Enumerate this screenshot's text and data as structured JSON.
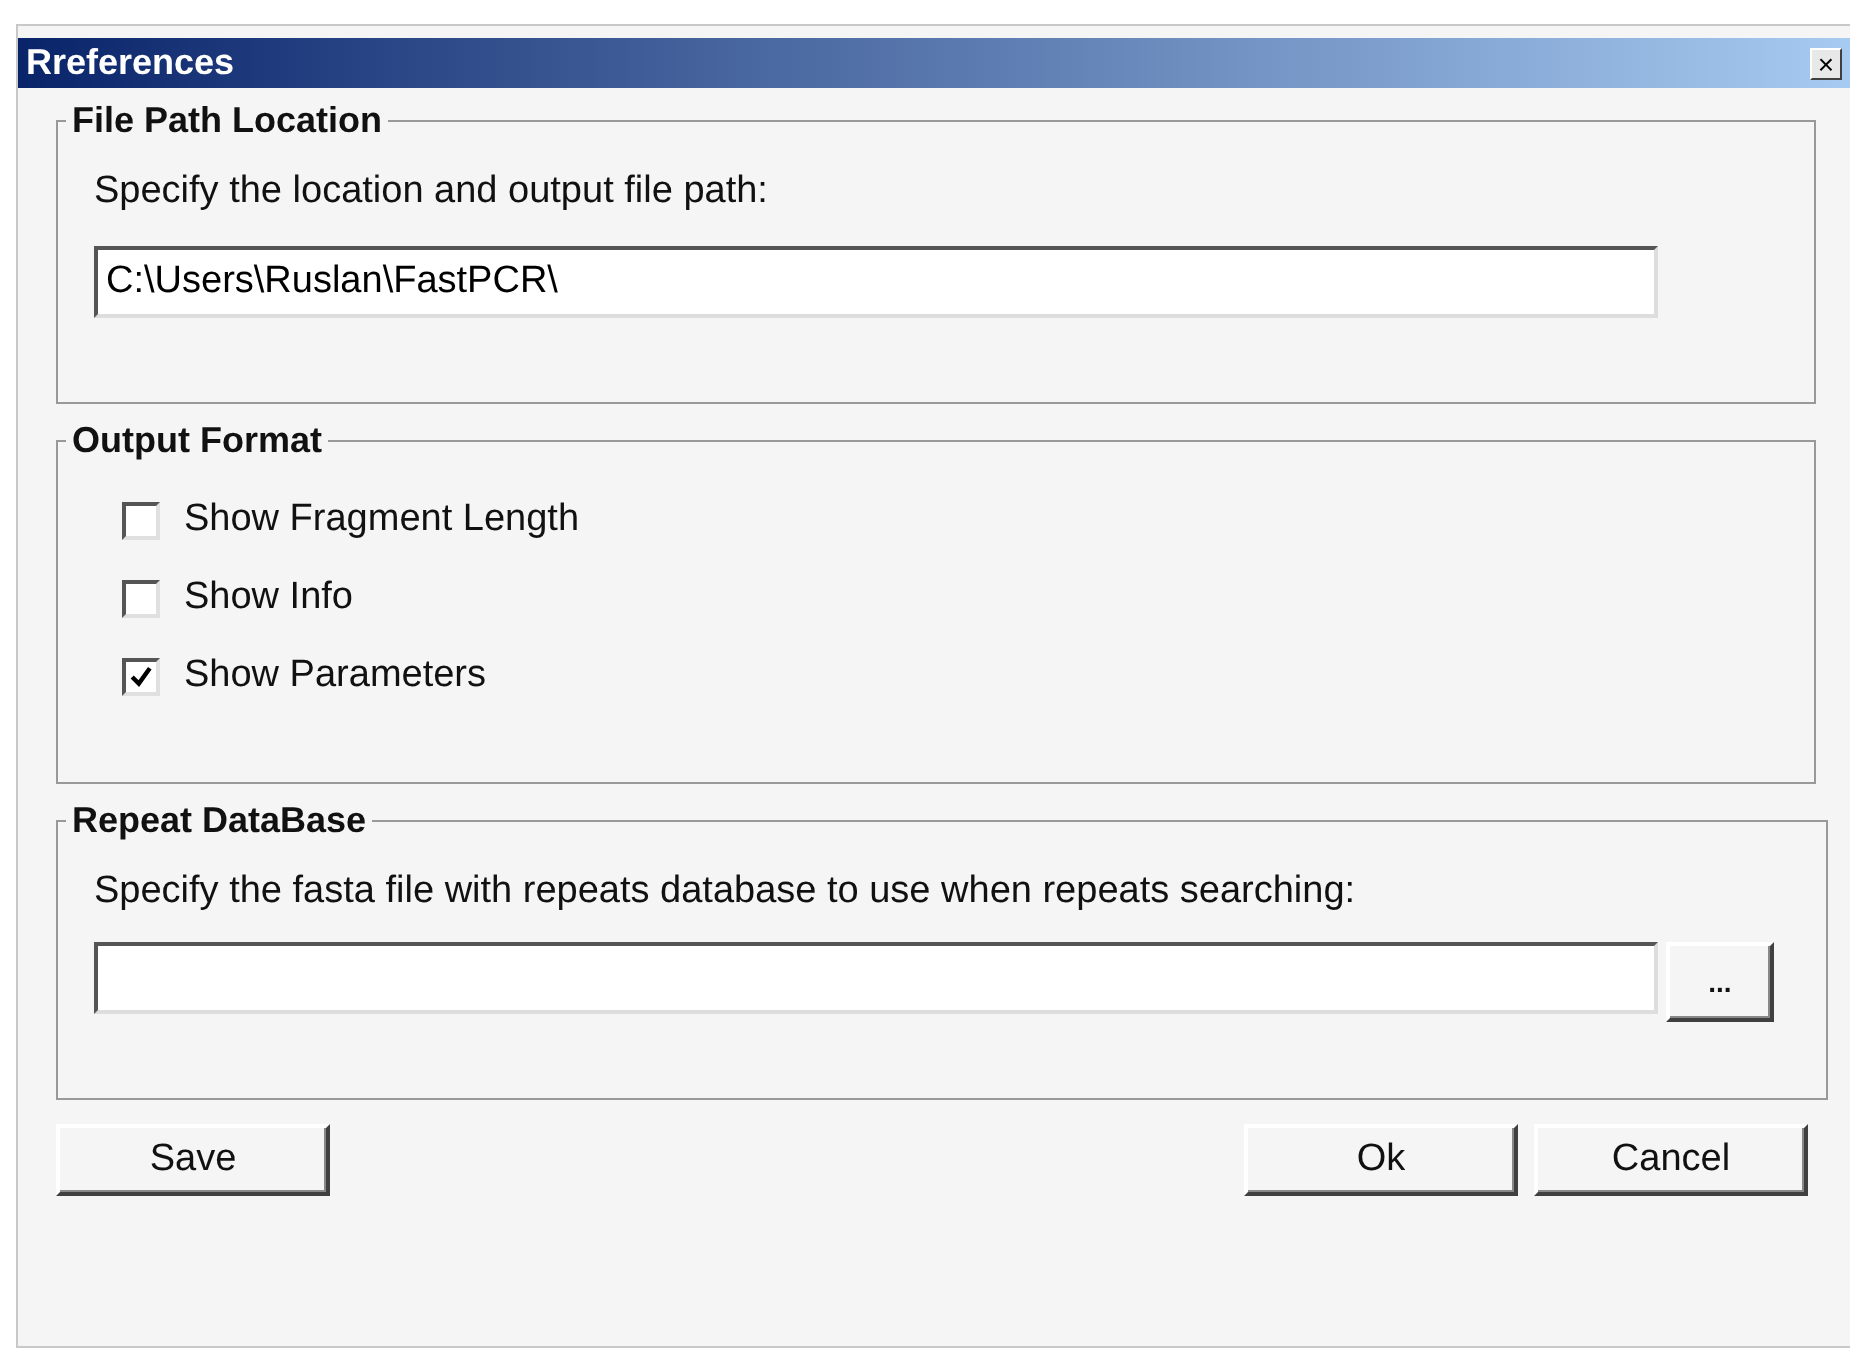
{
  "window": {
    "title": "Rreferences",
    "close": "×"
  },
  "file_path": {
    "title": "File Path Location",
    "label": "Specify the location and output file path:",
    "value": "C:\\Users\\Ruslan\\FastPCR\\"
  },
  "output_format": {
    "title": "Output Format",
    "options": [
      {
        "label": "Show Fragment Length",
        "checked": false
      },
      {
        "label": "Show Info",
        "checked": false
      },
      {
        "label": "Show Parameters",
        "checked": true
      }
    ]
  },
  "repeat_database": {
    "title": "Repeat DataBase",
    "label": "Specify the fasta file with repeats database to use when repeats searching:",
    "browse": "..."
  },
  "buttons": {
    "left": [
      "Save"
    ],
    "right": [
      "Ok",
      "Cancel"
    ]
  }
}
